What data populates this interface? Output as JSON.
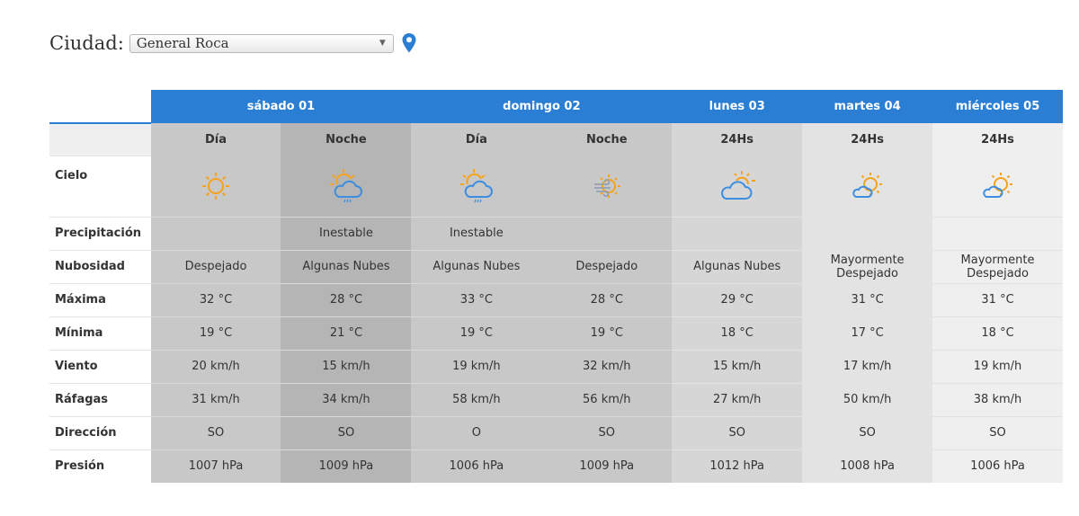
{
  "city": {
    "label": "Ciudad:",
    "selected": "General Roca"
  },
  "days": [
    "sábado 01",
    "domingo 02",
    "lunes 03",
    "martes 04",
    "miércoles 05"
  ],
  "periods": [
    "Día",
    "Noche",
    "Día",
    "Noche",
    "24Hs",
    "24Hs",
    "24Hs"
  ],
  "row_labels": {
    "cielo": "Cielo",
    "precipitacion": "Precipitación",
    "nubosidad": "Nubosidad",
    "maxima": "Máxima",
    "minima": "Mínima",
    "viento": "Viento",
    "rafagas": "Ráfagas",
    "direccion": "Dirección",
    "presion": "Presión"
  },
  "sky_icons": [
    "sun-icon",
    "sun-cloud-rain-icon",
    "sun-cloud-rain-icon",
    "sun-wind-icon",
    "sun-cloud-icon",
    "sun-small-cloud-icon",
    "sun-small-cloud-icon"
  ],
  "precipitacion": [
    "",
    "Inestable",
    "Inestable",
    "",
    "",
    "",
    ""
  ],
  "nubosidad": [
    "Despejado",
    "Algunas Nubes",
    "Algunas Nubes",
    "Despejado",
    "Algunas Nubes",
    "Mayormente Despejado",
    "Mayormente Despejado"
  ],
  "maxima": [
    "32 °C",
    "28 °C",
    "33 °C",
    "28 °C",
    "29 °C",
    "31 °C",
    "31 °C"
  ],
  "minima": [
    "19 °C",
    "21 °C",
    "19 °C",
    "19 °C",
    "18 °C",
    "17 °C",
    "18 °C"
  ],
  "viento": [
    "20 km/h",
    "15 km/h",
    "19 km/h",
    "32 km/h",
    "15 km/h",
    "17 km/h",
    "19 km/h"
  ],
  "rafagas": [
    "31 km/h",
    "34 km/h",
    "58 km/h",
    "56 km/h",
    "27 km/h",
    "50 km/h",
    "38 km/h"
  ],
  "direccion": [
    "SO",
    "SO",
    "O",
    "SO",
    "SO",
    "SO",
    "SO"
  ],
  "presion": [
    "1007 hPa",
    "1009 hPa",
    "1006 hPa",
    "1009 hPa",
    "1012 hPa",
    "1008 hPa",
    "1006 hPa"
  ],
  "colors": {
    "header_blue": "#2a7fd4",
    "sun_orange": "#f6a21a",
    "cloud_blue": "#3d8ee0",
    "pin_blue": "#2a7fd4"
  }
}
